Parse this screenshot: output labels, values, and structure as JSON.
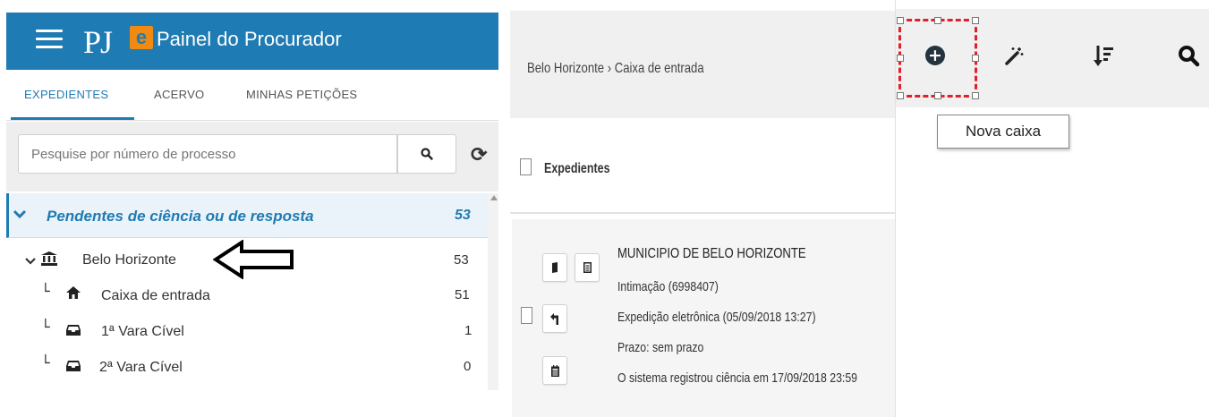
{
  "left_panel": {
    "app_title": "Painel do Procurador",
    "logo_text": "PJ",
    "logo_badge": "e",
    "tabs": [
      {
        "label": "EXPEDIENTES",
        "active": true
      },
      {
        "label": "ACERVO",
        "active": false
      },
      {
        "label": "MINHAS PETIÇÕES",
        "active": false
      }
    ],
    "search": {
      "placeholder": "Pesquise por número de processo",
      "value": ""
    },
    "pending": {
      "label": "Pendentes de ciência ou de resposta",
      "count": "53"
    },
    "tree": [
      {
        "label": "Belo Horizonte",
        "count": "53",
        "icon": "bank-icon"
      },
      {
        "label": "Caixa de entrada",
        "count": "51",
        "icon": "home-icon"
      },
      {
        "label": "1ª Vara Cível",
        "count": "1",
        "icon": "inbox-icon"
      },
      {
        "label": "2ª Vara Cível",
        "count": "0",
        "icon": "inbox-icon"
      }
    ],
    "accent_color": "#1f7bb3",
    "logo_color": "#f08a12"
  },
  "middle_panel": {
    "breadcrumb": "Belo Horizonte › Caixa de entrada",
    "section_title": "Expedientes",
    "card": {
      "title": "MUNICIPIO DE BELO HORIZONTE",
      "lines": [
        "Intimação (6998407)",
        "Expedição eletrônica (05/09/2018 13:27)",
        "Prazo: sem prazo",
        "O sistema registrou ciência em 17/09/2018 23:59"
      ]
    }
  },
  "right_panel": {
    "tooltip": "Nova caixa",
    "toolbar_icons": [
      "plus-circle-icon",
      "magic-wand-icon",
      "sort-icon",
      "search-icon"
    ],
    "highlight_color": "#e0202a"
  }
}
